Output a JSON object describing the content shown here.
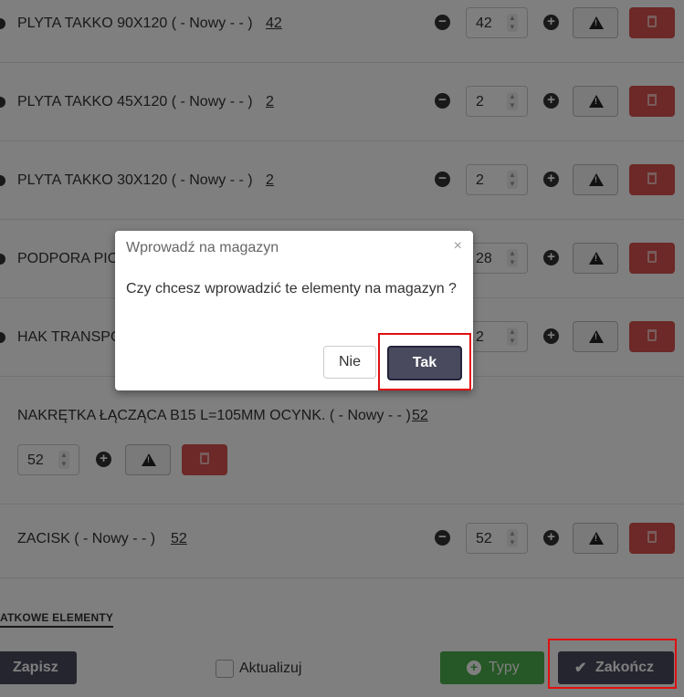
{
  "items": [
    {
      "label": "PLYTA TAKKO 90X120 ( - Nowy - - )",
      "qty_link": "42",
      "qty_value": "42"
    },
    {
      "label": "PLYTA TAKKO 45X120 ( - Nowy - - )",
      "qty_link": "2",
      "qty_value": "2"
    },
    {
      "label": "PLYTA TAKKO 30X120 ( - Nowy - - )",
      "qty_link": "2",
      "qty_value": "2"
    },
    {
      "label": "PODPORA PIO",
      "qty_link": "",
      "qty_value": "28"
    },
    {
      "label": "HAK TRANSPO",
      "qty_link": "",
      "qty_value": "2"
    },
    {
      "label": "NAKRĘTKA ŁĄCZĄCA B15 L=105MM OCYNK. ( - Nowy - - )",
      "qty_link": "52",
      "qty_value": "52"
    },
    {
      "label": "ZACISK ( - Nowy - - )",
      "qty_link": "52",
      "qty_value": "52"
    }
  ],
  "section_title": "ATKOWE ELEMENTY",
  "footer": {
    "save_label": "Zapisz",
    "update_label": "Aktualizuj",
    "types_label": "Typy",
    "finish_label": "Zakończ"
  },
  "modal": {
    "title": "Wprowadź na magazyn",
    "close": "×",
    "message": "Czy chcesz wprowadzić te elementy na magazyn ?",
    "no_label": "Nie",
    "yes_label": "Tak"
  },
  "colors": {
    "danger": "#d9534f",
    "success": "#4cae4c",
    "primary_dark": "#4a4a5e",
    "highlight": "#e01010"
  }
}
